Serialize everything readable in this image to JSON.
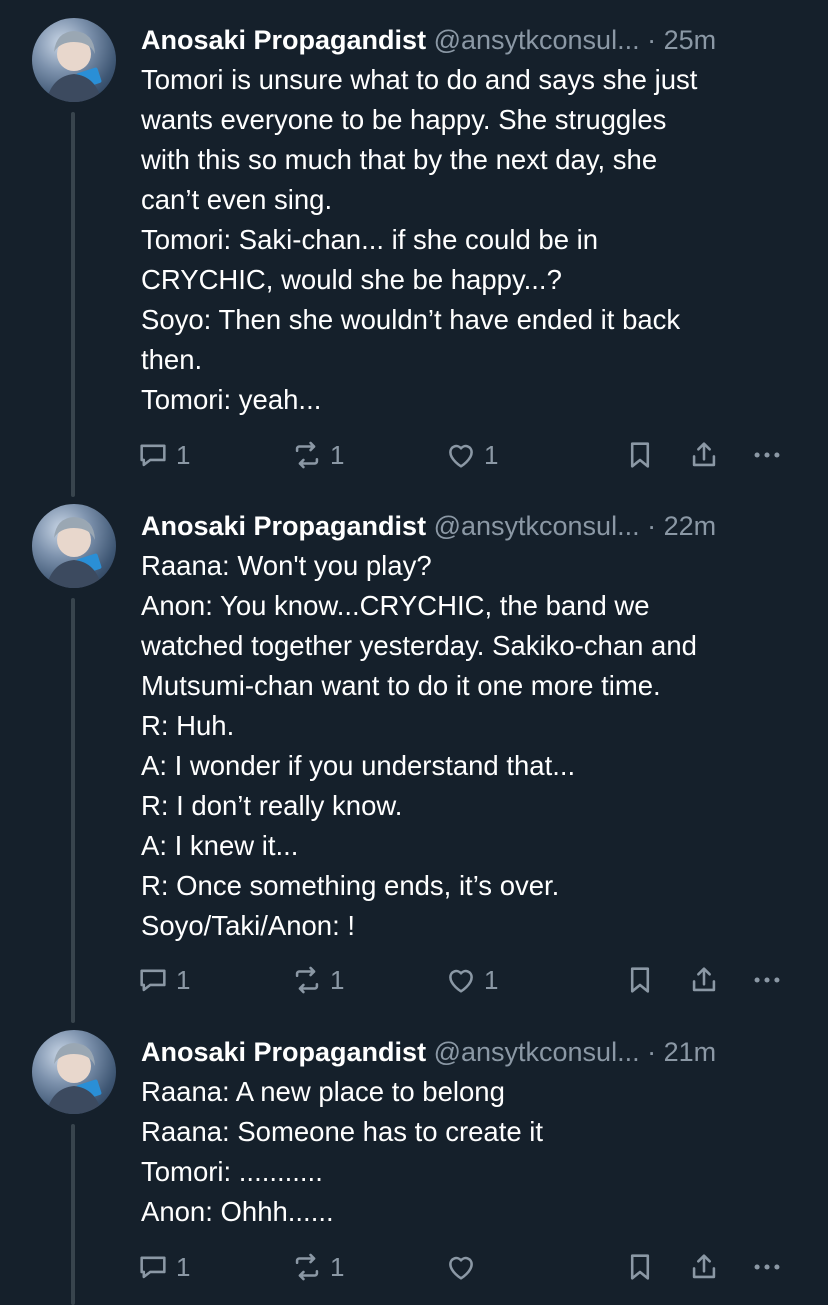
{
  "tweets": [
    {
      "author": "Anosaki Propagandist",
      "handle": "@ansytkconsul...",
      "sep": "·",
      "time": "25m",
      "lines": [
        "Tomori is unsure what to do and says she just",
        "wants everyone to be happy. She struggles",
        "with this so much that by the next day, she",
        "can’t even sing.",
        "Tomori: Saki-chan... if she could be in",
        "CRYCHIC, would she be happy...?",
        "Soyo: Then she wouldn’t have ended it back",
        "then.",
        "Tomori: yeah..."
      ],
      "replies": "1",
      "reposts": "1",
      "likes": "1"
    },
    {
      "author": "Anosaki Propagandist",
      "handle": "@ansytkconsul...",
      "sep": "·",
      "time": "22m",
      "lines": [
        "Raana: Won't you play?",
        "Anon: You know...CRYCHIC, the band we",
        "watched together yesterday. Sakiko-chan and",
        "Mutsumi-chan want to do it one more time.",
        "R: Huh.",
        "A: I wonder if you understand that...",
        "R: I don’t really know.",
        "A: I knew it...",
        "R: Once something ends, it’s over.",
        "Soyo/Taki/Anon: !"
      ],
      "replies": "1",
      "reposts": "1",
      "likes": "1"
    },
    {
      "author": "Anosaki Propagandist",
      "handle": "@ansytkconsul...",
      "sep": "·",
      "time": "21m",
      "lines": [
        "Raana: A new place to belong",
        "Raana: Someone has to create it",
        "Tomori: ...........",
        "Anon: Ohhh......"
      ],
      "replies": "1",
      "reposts": "1",
      "likes": ""
    }
  ],
  "icons": {
    "reply": "reply-icon",
    "repost": "repost-icon",
    "like": "heart-icon",
    "bookmark": "bookmark-icon",
    "share": "share-icon",
    "more": "more-icon"
  },
  "colors": {
    "background": "#15202b",
    "text": "#ffffff",
    "secondary": "#8b98a5",
    "thread_line": "#38444d"
  }
}
